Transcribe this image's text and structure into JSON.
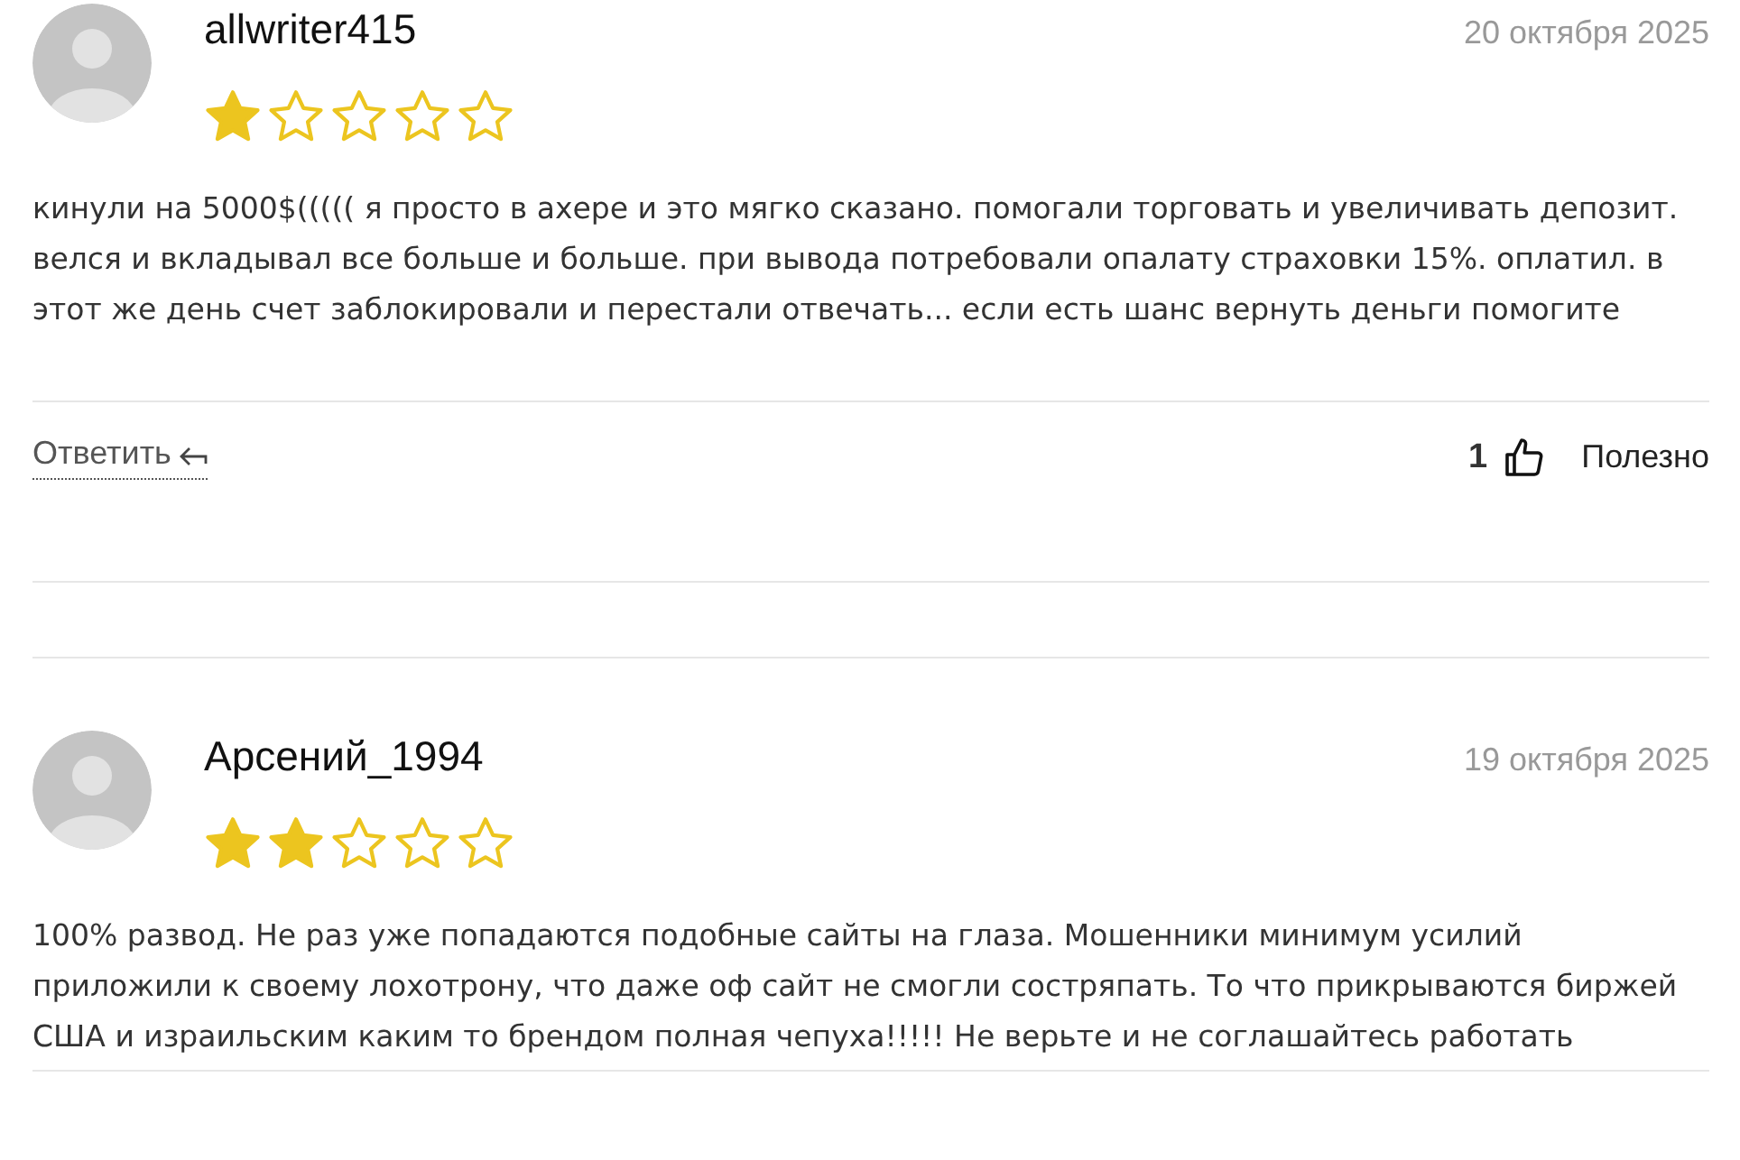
{
  "reviews": [
    {
      "author": "allwriter415",
      "date": "20 октября 2025",
      "stars": 1,
      "text": "кинули на 5000$((((( я просто в ахере и это мягко сказано. помогали торговать и увеличивать депозит. велся и вкладывал все больше и больше. при вывода потребовали опалату страховки 15%. оплатил. в этот же день счет заблокировали и перестали отвечать... если есть шанс вернуть деньги помогите",
      "actions": {
        "reply": "Ответить",
        "likes": "1",
        "helpful": "Полезно"
      }
    },
    {
      "author": "Арсений_1994",
      "date": "19 октября 2025",
      "stars": 2,
      "text": "100% развод. Не раз уже попадаются подобные сайты на глаза. Мошенники минимум усилий приложили к своему лохотрону, что даже оф сайт не смогли состряпать. То что прикрываются биржей США и израильским каким то брендом полная чепуха!!!!! Не верьте и не соглашайтесь работать"
    }
  ]
}
